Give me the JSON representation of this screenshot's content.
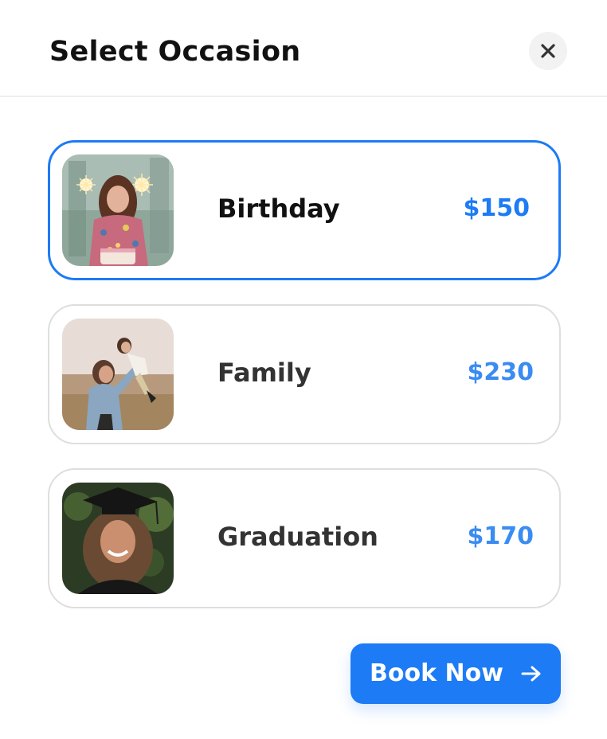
{
  "dialog": {
    "title": "Select Occasion",
    "close_icon": "close-icon"
  },
  "occasions": [
    {
      "label": "Birthday",
      "price": "$150",
      "selected": true,
      "image": "birthday-photo"
    },
    {
      "label": "Family",
      "price": "$230",
      "selected": false,
      "image": "family-photo"
    },
    {
      "label": "Graduation",
      "price": "$170",
      "selected": false,
      "image": "graduation-photo"
    }
  ],
  "actions": {
    "book_label": "Book Now",
    "book_icon": "arrow-right-icon"
  },
  "colors": {
    "accent": "#1d7bf5",
    "price": "#3a8cf2",
    "border": "#dedede",
    "text": "#111111"
  }
}
